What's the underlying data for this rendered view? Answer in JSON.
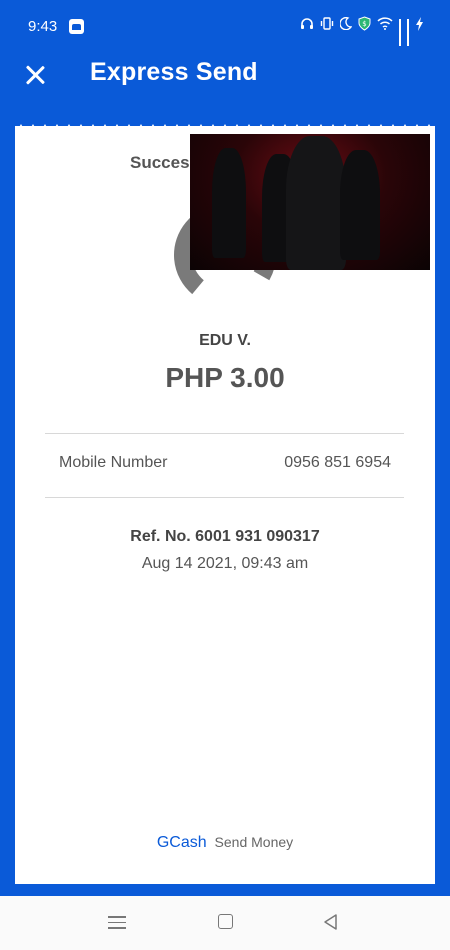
{
  "status_bar": {
    "time": "9:43",
    "icons": [
      "headphones-icon",
      "vibrate-icon",
      "moon-icon",
      "shield-icon",
      "wifi-icon",
      "signal-icon",
      "signal-icon",
      "charging-icon"
    ]
  },
  "header": {
    "title": "Express Send"
  },
  "receipt": {
    "status_label": "Succes",
    "recipient_name": "EDU V.",
    "amount": "PHP 3.00",
    "details": [
      {
        "label": "Mobile Number",
        "value": "0956 851 6954"
      }
    ],
    "reference": "Ref. No. 6001 931 090317",
    "date": "Aug 14 2021, 09:43 am"
  },
  "footer": {
    "brand": "GCash",
    "subtitle": "Send Money"
  },
  "colors": {
    "brand_blue": "#0a5ad8",
    "text_gray": "#555555",
    "icon_gray": "#7a7a7a"
  }
}
